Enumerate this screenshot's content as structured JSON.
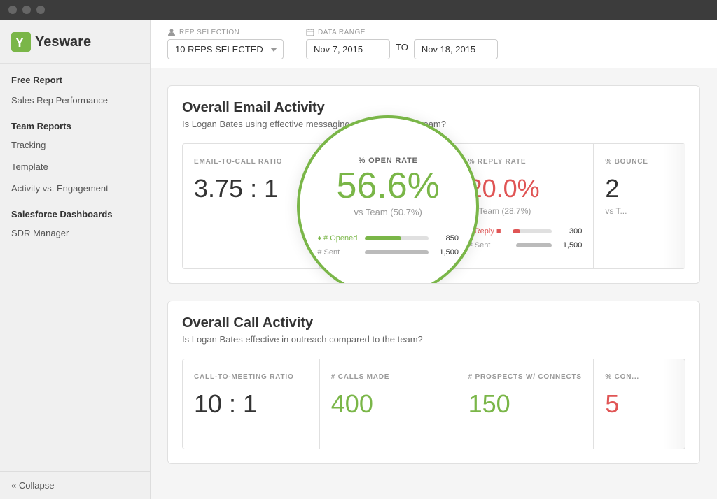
{
  "titlebar": {
    "dots": [
      "dot1",
      "dot2",
      "dot3"
    ]
  },
  "sidebar": {
    "logo_text": "Yesware",
    "free_report_label": "Free Report",
    "sales_rep_label": "Sales Rep Performance",
    "team_reports_label": "Team Reports",
    "tracking_label": "Tracking",
    "template_label": "Template",
    "activity_label": "Activity vs. Engagement",
    "salesforce_label": "Salesforce Dashboards",
    "sdr_label": "SDR Manager",
    "collapse_label": "« Collapse"
  },
  "header": {
    "rep_selection_label": "REP SELECTION",
    "rep_value": "10 REPS SELECTED",
    "data_range_label": "DATA RANGE",
    "date_from": "Nov 7, 2015",
    "date_to_label": "TO",
    "date_to": "Nov 18, 2015"
  },
  "email_section": {
    "title": "Overall Email Activity",
    "subtitle": "Is Logan Bates using effective messaging compared to the team?",
    "metrics": [
      {
        "label": "EMAIL-TO-CALL RATIO",
        "value": "3.75 : 1",
        "value_color": "dark",
        "vs": null,
        "bars": null
      },
      {
        "label": "% OPEN RATE",
        "value": "56.6%",
        "value_color": "green",
        "vs": "vs Team (50.7%)",
        "bars": [
          {
            "type": "green",
            "label": "# Opened",
            "count": "850",
            "pct": 57
          },
          {
            "type": "gray",
            "label": "# Sent",
            "count": "1,500",
            "pct": 100
          }
        ],
        "highlighted": true
      },
      {
        "label": "% REPLY RATE",
        "value": "20.0%",
        "value_color": "red",
        "vs": "vs Team (28.7%)",
        "bars": [
          {
            "type": "red",
            "label": "# Reply",
            "count": "300",
            "pct": 20
          },
          {
            "type": "gray",
            "label": "# Sent",
            "count": "1,500",
            "pct": 100
          }
        ]
      },
      {
        "label": "% BOUNCE",
        "value": "2",
        "value_color": "dark",
        "vs": "vs T...",
        "partial": true
      }
    ]
  },
  "call_section": {
    "title": "Overall Call Activity",
    "subtitle": "Is Logan Bates effective in outreach compared to the team?",
    "metrics": [
      {
        "label": "CALL-TO-MEETING RATIO",
        "value": "10 : 1",
        "value_color": "dark"
      },
      {
        "label": "# CALLS MADE",
        "value": "400",
        "value_color": "green"
      },
      {
        "label": "# PROSPECTS W/ CONNECTS",
        "value": "150",
        "value_color": "green"
      },
      {
        "label": "% CON...",
        "value": "5",
        "value_color": "red",
        "partial": true
      }
    ]
  }
}
